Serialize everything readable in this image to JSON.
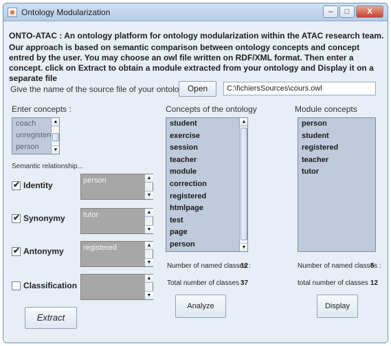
{
  "window": {
    "title": "Ontology Modularization"
  },
  "intro": {
    "line1": "ONTO-ATAC : An ontology platform for ontology modularization within the ATAC research team.",
    "line2": "Our approach is based on semantic comparison between ontology concepts and concept entred by the user. You may choose an owl file written on RDF/XML format. Then enter a concept. click on Extract to obtain a module extracted from your ontology and Display it on a separate file"
  },
  "source": {
    "label": "Give the name of the source file of your ontology",
    "open_label": "Open",
    "path_value": "C:\\fichiersSources\\cours.owl"
  },
  "enter_concepts": {
    "label": "Enter concepts :",
    "items": [
      "coach",
      "unregistered",
      "person"
    ]
  },
  "semantic": {
    "label": "Semantic relationship...",
    "rows": [
      {
        "label": "Identity",
        "checked": true,
        "value": "person"
      },
      {
        "label": "Synonymy",
        "checked": true,
        "value": "tutor"
      },
      {
        "label": "Antonymy",
        "checked": true,
        "value": "registered"
      },
      {
        "label": "Classification",
        "checked": false,
        "value": ""
      }
    ]
  },
  "ontology": {
    "label": "Concepts of the ontology",
    "items": [
      "student",
      "exercise",
      "session",
      "teacher",
      "module",
      "correction",
      "registered",
      "htmlpage",
      "test",
      "page",
      "person"
    ],
    "named_label": "Number of named classes :",
    "named_value": "12",
    "total_label": "Total number of classes :",
    "total_value": "37",
    "analyze_label": "Analyze"
  },
  "module": {
    "label": "Module concepts",
    "items": [
      "person",
      "student",
      "registered",
      "teacher",
      "tutor"
    ],
    "named_label": "Number of named classes :",
    "named_value": "5",
    "total_label": "total number of classes :",
    "total_value": "12",
    "display_label": "Display"
  },
  "extract_label": "Extract"
}
